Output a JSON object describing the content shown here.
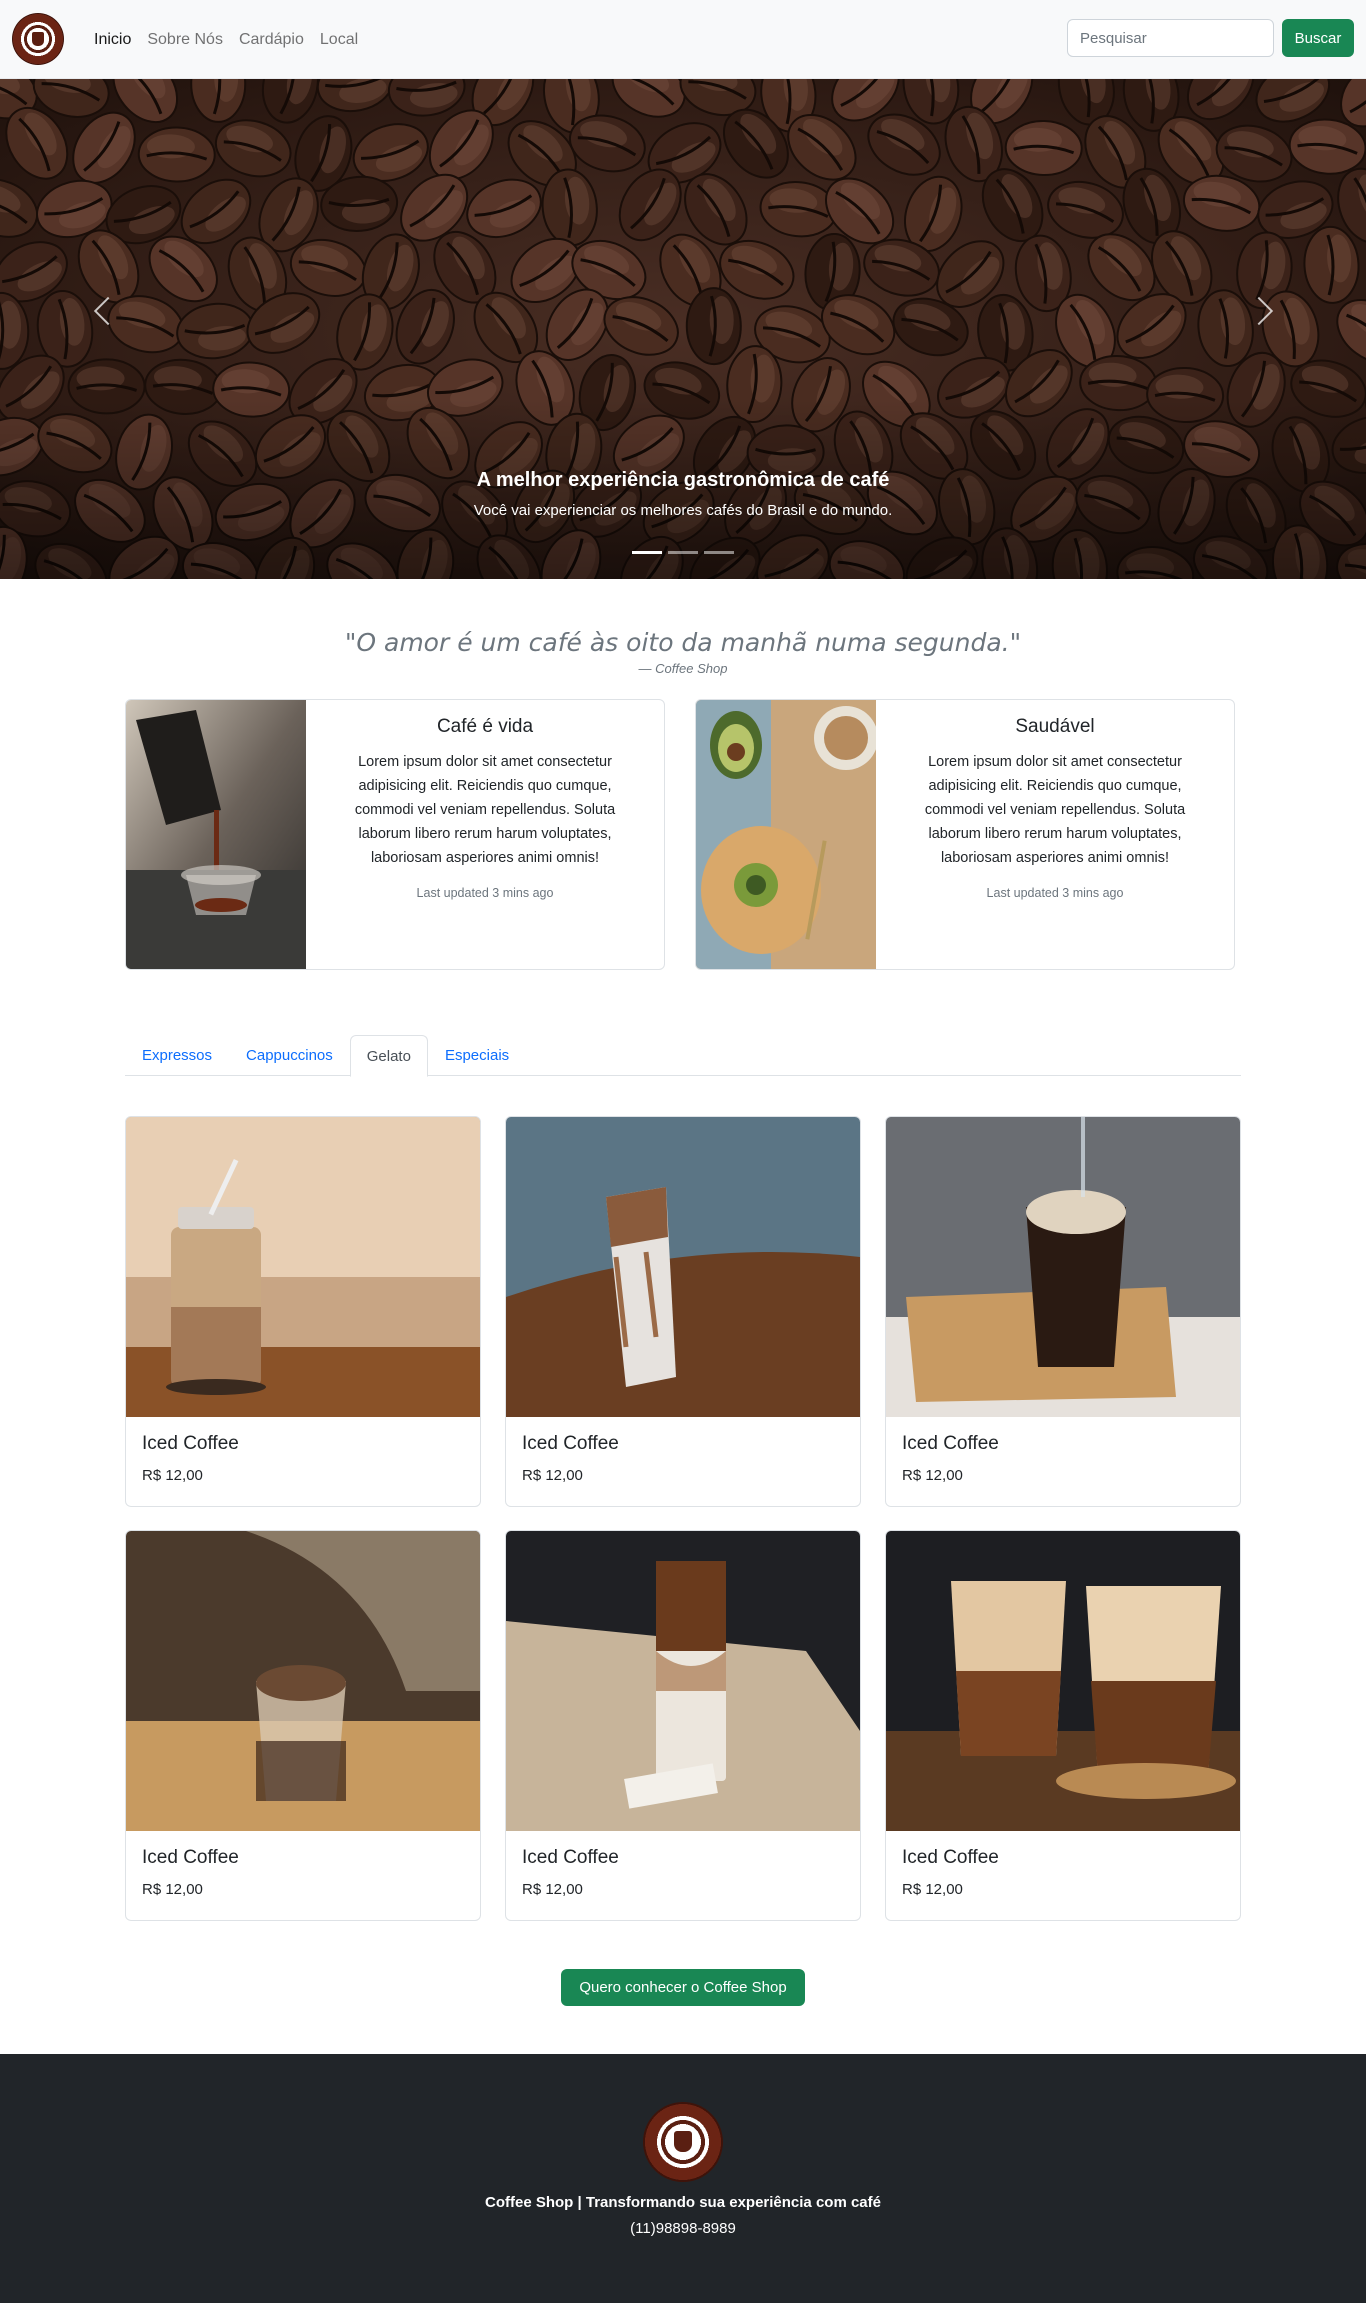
{
  "nav": {
    "links": [
      "Inicio",
      "Sobre Nós",
      "Cardápio",
      "Local"
    ],
    "active": "Inicio",
    "search_placeholder": "Pesquisar",
    "search_button": "Buscar"
  },
  "carousel": {
    "slides": 3,
    "active_slide": 1,
    "title": "A melhor experiência gastronômica de café",
    "subtitle": "Você vai experienciar os melhores cafés do Brasil e do mundo."
  },
  "quote": {
    "text": "\"O amor é um café às oito da manhã numa segunda.\"",
    "author": "— Coffee Shop"
  },
  "features": [
    {
      "title": "Café é vida",
      "text": "Lorem ipsum dolor sit amet consectetur adipisicing elit. Reiciendis quo cumque, commodi vel veniam repellendus. Soluta laborum libero rerum harum voluptates, laboriosam asperiores animi omnis!",
      "updated": "Last updated 3 mins ago"
    },
    {
      "title": "Saudável",
      "text": "Lorem ipsum dolor sit amet consectetur adipisicing elit. Reiciendis quo cumque, commodi vel veniam repellendus. Soluta laborum libero rerum harum voluptates, laboriosam asperiores animi omnis!",
      "updated": "Last updated 3 mins ago"
    }
  ],
  "tabs": [
    "Expressos",
    "Cappuccinos",
    "Gelato",
    "Especiais"
  ],
  "active_tab": "Gelato",
  "products": [
    {
      "name": "Iced Coffee",
      "price": "R$ 12,00"
    },
    {
      "name": "Iced Coffee",
      "price": "R$ 12,00"
    },
    {
      "name": "Iced Coffee",
      "price": "R$ 12,00"
    },
    {
      "name": "Iced Coffee",
      "price": "R$ 12,00"
    },
    {
      "name": "Iced Coffee",
      "price": "R$ 12,00"
    },
    {
      "name": "Iced Coffee",
      "price": "R$ 12,00"
    }
  ],
  "cta": "Quero conhecer o Coffee Shop",
  "footer": {
    "text": "Coffee Shop | Transformando sua experiência com café",
    "phone": "(11)98898-8989"
  },
  "colors": {
    "primary_button": "#198754",
    "link": "#0d6efd",
    "footer_bg": "#212529",
    "navbar_bg": "#f8f9fa"
  }
}
